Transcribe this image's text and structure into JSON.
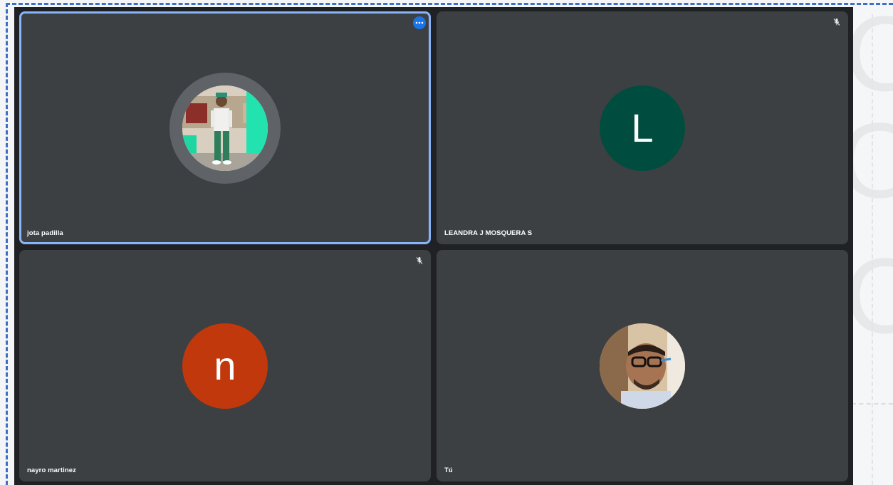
{
  "participants": [
    {
      "name": "jota padilla",
      "avatar": "photo",
      "active": true,
      "muted": false,
      "control": "more-options-icon"
    },
    {
      "name": "LEANDRA J MOSQUERA S",
      "avatar_letter": "L",
      "avatar_color": "#004d40",
      "muted": true
    },
    {
      "name": "nayro martinez",
      "avatar_letter": "n",
      "avatar_color": "#c1380c",
      "muted": true
    },
    {
      "name": "Tú",
      "avatar": "photo",
      "muted": false
    }
  ],
  "colors": {
    "stage_bg": "#202124",
    "tile_bg": "#3c4043",
    "active_border": "#8ab4f8",
    "menu_button": "#1a73e8",
    "selection_dash": "#3d6fc4"
  }
}
